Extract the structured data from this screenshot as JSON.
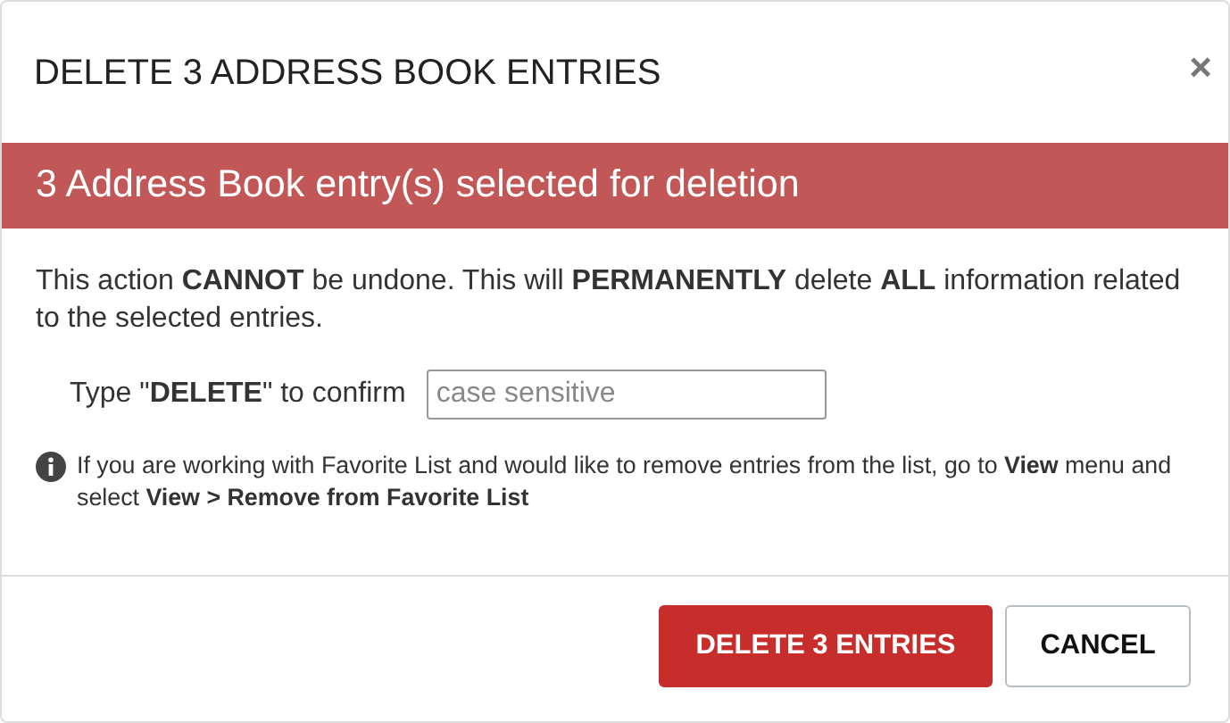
{
  "dialog": {
    "title": "DELETE 3 ADDRESS BOOK ENTRIES",
    "close": "×"
  },
  "banner": "3 Address Book entry(s) selected for deletion",
  "warning": "This action **CANNOT** be undone. This will **PERMANENTLY** delete **ALL** information related to the selected entries.",
  "confirm": {
    "label": "Type \"**DELETE**\" to confirm",
    "placeholder": "case sensitive"
  },
  "info": "If you are working with Favorite List and would like to remove entries from the list, go to **View** menu and select **View > Remove from Favorite List**",
  "buttons": [
    {
      "label": "DELETE 3 ENTRIES",
      "kind": "danger"
    },
    {
      "label": "CANCEL",
      "kind": "default"
    }
  ]
}
